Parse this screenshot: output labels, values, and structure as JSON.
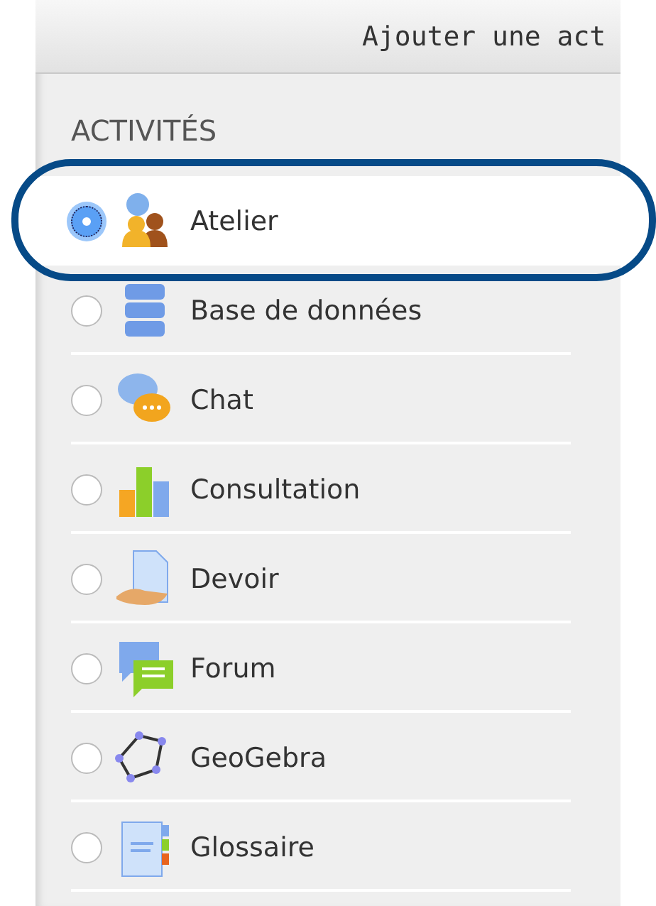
{
  "header": {
    "title": "Ajouter une act"
  },
  "section": {
    "title": "ACTIVITÉS"
  },
  "items": [
    {
      "label": "Atelier",
      "selected": true
    },
    {
      "label": "Base de données",
      "selected": false
    },
    {
      "label": "Chat",
      "selected": false
    },
    {
      "label": "Consultation",
      "selected": false
    },
    {
      "label": "Devoir",
      "selected": false
    },
    {
      "label": "Forum",
      "selected": false
    },
    {
      "label": "GeoGebra",
      "selected": false
    },
    {
      "label": "Glossaire",
      "selected": false
    }
  ]
}
